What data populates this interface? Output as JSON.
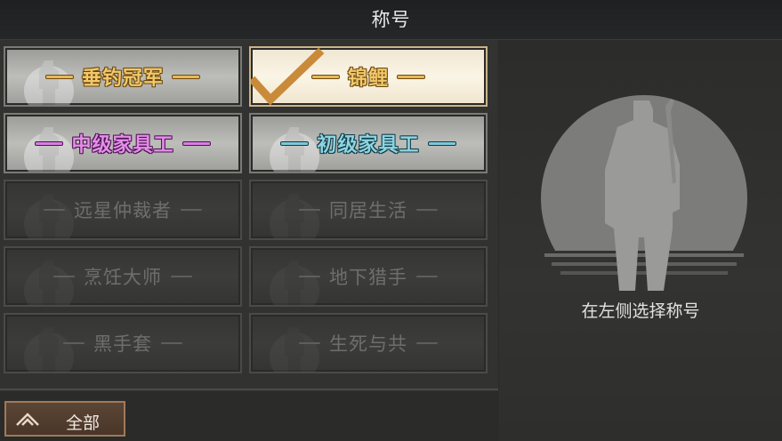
{
  "header": {
    "title": "称号"
  },
  "titles": [
    {
      "label": "垂钓冠军",
      "state": "unlocked",
      "color": "gold"
    },
    {
      "label": "锦鲤",
      "state": "selected",
      "color": "gold"
    },
    {
      "label": "中级家具工",
      "state": "unlocked",
      "color": "purple"
    },
    {
      "label": "初级家具工",
      "state": "unlocked",
      "color": "cyan"
    },
    {
      "label": "远星仲裁者",
      "state": "locked",
      "color": "gray"
    },
    {
      "label": "同居生活",
      "state": "locked",
      "color": "gray"
    },
    {
      "label": "烹饪大师",
      "state": "locked",
      "color": "gray"
    },
    {
      "label": "地下猎手",
      "state": "locked",
      "color": "gray"
    },
    {
      "label": "黑手套",
      "state": "locked",
      "color": "gray"
    },
    {
      "label": "生死与共",
      "state": "locked",
      "color": "gray"
    }
  ],
  "filter": {
    "label": "全部",
    "icon": "chevron-up-icon"
  },
  "preview": {
    "hint": "在左侧选择称号",
    "icon": "soldier-silhouette-icon"
  },
  "colors": {
    "gold": "#f2c86a",
    "purple": "#e48ee8",
    "cyan": "#8fd4e0",
    "selected_check": "#c98a3a"
  }
}
